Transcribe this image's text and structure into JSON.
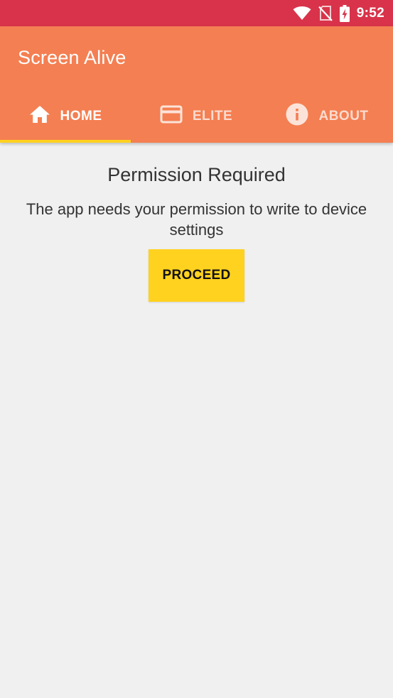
{
  "status_bar": {
    "time": "9:52",
    "icons": [
      "wifi-icon",
      "no-sim-icon",
      "battery-charging-icon"
    ]
  },
  "app_bar": {
    "title": "Screen Alive"
  },
  "tabs": [
    {
      "label": "HOME",
      "icon": "home-icon",
      "selected": true
    },
    {
      "label": "ELITE",
      "icon": "credit-card-icon",
      "selected": false
    },
    {
      "label": "ABOUT",
      "icon": "info-icon",
      "selected": false
    }
  ],
  "main": {
    "title": "Permission Required",
    "message": "The app needs your permission to write to device settings",
    "button_label": "PROCEED"
  },
  "colors": {
    "status_bar": "#d8334a",
    "app_bar": "#f47f52",
    "accent": "#ffd21f",
    "background": "#f0f0f0",
    "text": "#333333"
  }
}
